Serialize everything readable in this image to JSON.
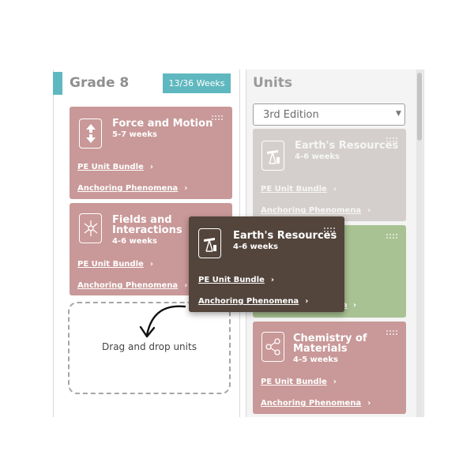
{
  "grade": {
    "title": "Grade 8",
    "weeks_badge": "13/36 Weeks"
  },
  "units_panel": {
    "title": "Units",
    "edition_select": "3rd Edition"
  },
  "grade_cards": [
    {
      "title": "Force and Motion",
      "weeks": "5-7 weeks",
      "icon": "force-arrows-icon",
      "link_bundle": "PE Unit Bundle",
      "link_phenomena": "Anchoring Phenomena",
      "color": "#c99898"
    },
    {
      "title_line1": "Fields and",
      "title_line2": "Interactions",
      "weeks": "4-6 weeks",
      "icon": "magnet-fields-icon",
      "link_bundle": "PE Unit Bundle",
      "link_phenomena": "Anchoring Phenomena",
      "color": "#c99898"
    }
  ],
  "unit_cards": [
    {
      "title": "Earth's Resources",
      "weeks": "4-6 weeks",
      "icon": "oil-pump-icon",
      "link_bundle": "PE Unit Bundle",
      "link_phenomena": "Anchoring Phenomena",
      "color": "#d4cfcc"
    },
    {
      "link_phenomena_partial": "a",
      "color": "#a9c293"
    },
    {
      "title_line1": "Chemistry of",
      "title_line2": "Materials",
      "weeks": "4-5 weeks",
      "icon": "molecule-icon",
      "link_bundle": "PE Unit Bundle",
      "link_phenomena": "Anchoring Phenomena",
      "color": "#c99898"
    }
  ],
  "dragged_card": {
    "title": "Earth's Resources",
    "weeks": "4-6 weeks",
    "icon": "oil-pump-icon",
    "link_bundle": "PE Unit Bundle",
    "link_phenomena": "Anchoring Phenomena",
    "color": "#53453c"
  },
  "dropzone": {
    "text": "Drag and drop units"
  },
  "chevron": "›"
}
